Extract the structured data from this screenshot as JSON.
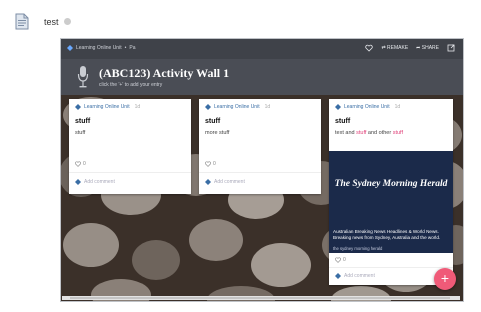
{
  "doc": {
    "title": "test"
  },
  "padlet": {
    "breadcrumb": {
      "owner": "Learning Online Unit",
      "separator": "•",
      "label": "Pa"
    },
    "actions": {
      "remake": "REMAKE",
      "share": "SHARE"
    },
    "header": {
      "title": "(ABC123) Activity Wall 1",
      "subtitle": "click the '+' to add your entry"
    },
    "posts": [
      {
        "author": "Learning Online Unit",
        "time": "1d",
        "title": "stuff",
        "body": "stuff",
        "likes": "0",
        "add_comment": "Add comment"
      },
      {
        "author": "Learning Online Unit",
        "time": "1d",
        "title": "stuff",
        "body": "more stuff",
        "likes": "0",
        "add_comment": "Add comment"
      },
      {
        "author": "Learning Online Unit",
        "time": "1d",
        "title": "stuff",
        "body_parts": [
          "text and ",
          "stuff",
          " and other ",
          "stuff"
        ],
        "likes": "0",
        "add_comment": "Add comment",
        "link": {
          "logo_text": "The Sydney Morning Herald",
          "caption": "Australian Breaking News Headlines & World News. Breaking news from Sydney, Australia and the world.",
          "source": "the sydney morning herald"
        }
      }
    ],
    "fab_label": "+"
  },
  "colors": {
    "accent_pink": "#f05a78",
    "author_blue": "#3a6ea5",
    "header_bg": "#4a4d55",
    "smh_bg": "#1b2a4a"
  },
  "icons": [
    "document-icon",
    "padlet-logo-icon",
    "microphone-icon",
    "heart-icon",
    "remake-icon",
    "share-icon",
    "expand-icon",
    "avatar-icon",
    "plus-icon"
  ]
}
